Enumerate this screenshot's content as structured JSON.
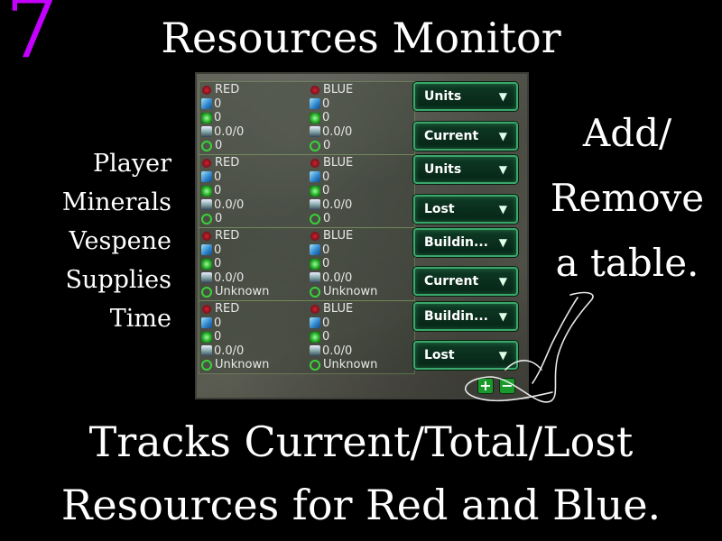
{
  "badge": "7",
  "title": "Resources Monitor",
  "legend": [
    "Player",
    "Minerals",
    "Vespene",
    "Supplies",
    "Time"
  ],
  "note": [
    "Add/",
    "Remove",
    "a table."
  ],
  "footer": [
    "Tracks Current/Total/Lost",
    "Resources for Red and Blue."
  ],
  "tables": [
    {
      "red": {
        "player": "RED",
        "minerals": "0",
        "vespene": "0",
        "supplies": "0.0/0",
        "time": "0"
      },
      "blue": {
        "player": "BLUE",
        "minerals": "0",
        "vespene": "0",
        "supplies": "0.0/0",
        "time": "0"
      },
      "buttons": [
        "Units",
        "Current"
      ]
    },
    {
      "red": {
        "player": "RED",
        "minerals": "0",
        "vespene": "0",
        "supplies": "0.0/0",
        "time": "0"
      },
      "blue": {
        "player": "BLUE",
        "minerals": "0",
        "vespene": "0",
        "supplies": "0.0/0",
        "time": "0"
      },
      "buttons": [
        "Units",
        "Lost"
      ]
    },
    {
      "red": {
        "player": "RED",
        "minerals": "0",
        "vespene": "0",
        "supplies": "0.0/0",
        "time": "Unknown"
      },
      "blue": {
        "player": "BLUE",
        "minerals": "0",
        "vespene": "0",
        "supplies": "0.0/0",
        "time": "Unknown"
      },
      "buttons": [
        "Buildin...",
        "Current"
      ]
    },
    {
      "red": {
        "player": "RED",
        "minerals": "0",
        "vespene": "0",
        "supplies": "0.0/0",
        "time": "Unknown"
      },
      "blue": {
        "player": "BLUE",
        "minerals": "0",
        "vespene": "0",
        "supplies": "0.0/0",
        "time": "Unknown"
      },
      "buttons": [
        "Buildin...",
        "Lost"
      ]
    }
  ],
  "controls": {
    "add": "+",
    "remove": "−"
  },
  "icons": {
    "player": "player-emblem-icon",
    "minerals": "minerals-icon",
    "vespene": "vespene-icon",
    "supplies": "supply-icon",
    "time": "clock-icon",
    "dropdown": "chevron-down-icon"
  },
  "colors": {
    "badge": "#c400ff",
    "button_border": "#3aa86a",
    "button_bg": "#062416"
  }
}
